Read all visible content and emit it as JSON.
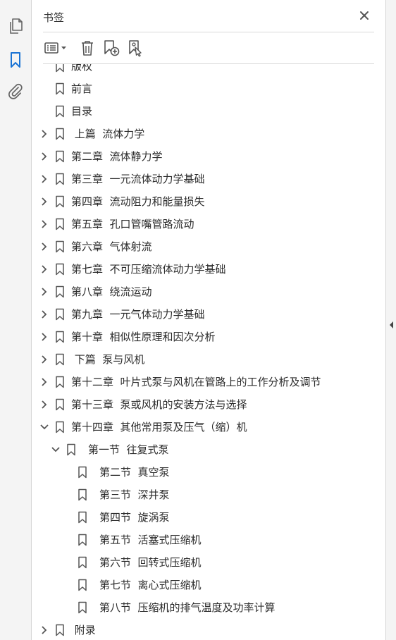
{
  "panel": {
    "title": "书签"
  },
  "leftbar": {
    "icons": [
      "pages-icon",
      "bookmark-icon",
      "attachment-icon"
    ]
  },
  "toolbar": {
    "icons": [
      "options-menu-icon",
      "delete-icon",
      "new-bookmark-icon",
      "bookmark-from-structure-icon"
    ]
  },
  "bookmarks": [
    {
      "label": "版权",
      "chevron": "none"
    },
    {
      "label": "前言",
      "chevron": "none"
    },
    {
      "label": "目录",
      "chevron": "none"
    },
    {
      "label": " 上篇  流体力学",
      "chevron": "right"
    },
    {
      "label": "第二章  流体静力学",
      "chevron": "right"
    },
    {
      "label": "第三章  一元流体动力学基础",
      "chevron": "right"
    },
    {
      "label": "第四章  流动阻力和能量损失",
      "chevron": "right"
    },
    {
      "label": "第五章  孔口管嘴管路流动",
      "chevron": "right"
    },
    {
      "label": "第六章  气体射流",
      "chevron": "right"
    },
    {
      "label": "第七章  不可压缩流体动力学基础",
      "chevron": "right"
    },
    {
      "label": "第八章  绕流运动",
      "chevron": "right"
    },
    {
      "label": "第九章  一元气体动力学基础",
      "chevron": "right"
    },
    {
      "label": "第十章  相似性原理和因次分析",
      "chevron": "right"
    },
    {
      "label": " 下篇  泵与风机",
      "chevron": "right"
    },
    {
      "label": "第十二章  叶片式泵与风机在管路上的工作分析及调节",
      "chevron": "right"
    },
    {
      "label": "第十三章  泵或风机的安装方法与选择",
      "chevron": "right"
    },
    {
      "label": "第十四章  其他常用泵及压气（缩）机",
      "chevron": "down"
    },
    {
      "label": "第一节  往复式泵",
      "chevron": "down"
    },
    {
      "label": "第二节  真空泵",
      "chevron": "none"
    },
    {
      "label": "第三节  深井泵",
      "chevron": "none"
    },
    {
      "label": "第四节  旋涡泵",
      "chevron": "none"
    },
    {
      "label": "第五节  活塞式压缩机",
      "chevron": "none"
    },
    {
      "label": "第六节  回转式压缩机",
      "chevron": "none"
    },
    {
      "label": "第七节  离心式压缩机",
      "chevron": "none"
    },
    {
      "label": "第八节  压缩机的排气温度及功率计算",
      "chevron": "none"
    },
    {
      "label": " 附录",
      "chevron": "right"
    }
  ]
}
